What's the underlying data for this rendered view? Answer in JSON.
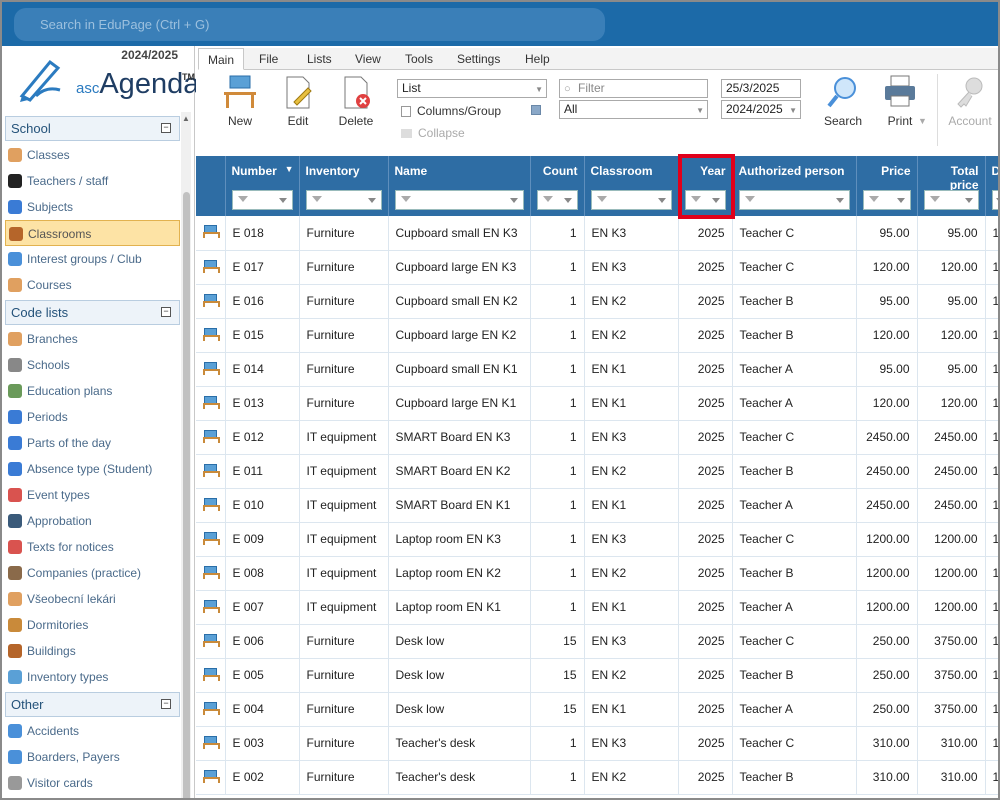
{
  "search": {
    "placeholder": "Search in EduPage (Ctrl + G)"
  },
  "logo": {
    "year": "2024/2025",
    "brand_prefix": "asc",
    "brand_name": "Agenda",
    "tm": "TM"
  },
  "sidebar": {
    "sections": [
      {
        "title": "School",
        "items": [
          {
            "label": "Classes",
            "icon": "classes-icon",
            "color": "#e0a060"
          },
          {
            "label": "Teachers / staff",
            "icon": "teacher-hat-icon",
            "color": "#222222"
          },
          {
            "label": "Subjects",
            "icon": "subjects-icon",
            "color": "#3a7bd5"
          },
          {
            "label": "Classrooms",
            "icon": "door-icon",
            "color": "#b5652a",
            "active": true
          },
          {
            "label": "Interest groups / Club",
            "icon": "groups-icon",
            "color": "#4a90d9"
          },
          {
            "label": "Courses",
            "icon": "courses-icon",
            "color": "#e0a060"
          }
        ]
      },
      {
        "title": "Code lists",
        "items": [
          {
            "label": "Branches",
            "icon": "branches-icon",
            "color": "#e0a060"
          },
          {
            "label": "Schools",
            "icon": "school-building-icon",
            "color": "#888888"
          },
          {
            "label": "Education plans",
            "icon": "education-plans-icon",
            "color": "#6a9a5a"
          },
          {
            "label": "Periods",
            "icon": "clock-icon",
            "color": "#3a7bd5"
          },
          {
            "label": "Parts of the day",
            "icon": "clock-icon",
            "color": "#3a7bd5"
          },
          {
            "label": "Absence type (Student)",
            "icon": "clock-icon",
            "color": "#3a7bd5"
          },
          {
            "label": "Event types",
            "icon": "calendar-icon",
            "color": "#d9534f"
          },
          {
            "label": "Approbation",
            "icon": "approbation-icon",
            "color": "#3a5a7a"
          },
          {
            "label": "Texts for notices",
            "icon": "pin-icon",
            "color": "#d9534f"
          },
          {
            "label": "Companies (practice)",
            "icon": "companies-icon",
            "color": "#8a6a4a"
          },
          {
            "label": "Všeobecní lekári",
            "icon": "doctor-icon",
            "color": "#e0a060"
          },
          {
            "label": "Dormitories",
            "icon": "dormitory-icon",
            "color": "#c98a3a"
          },
          {
            "label": "Buildings",
            "icon": "building-icon",
            "color": "#b5652a"
          },
          {
            "label": "Inventory types",
            "icon": "inventory-icon",
            "color": "#5aa0d6"
          }
        ]
      },
      {
        "title": "Other",
        "items": [
          {
            "label": "Accidents",
            "icon": "accidents-icon",
            "color": "#4a90d9"
          },
          {
            "label": "Boarders, Payers",
            "icon": "boarders-icon",
            "color": "#4a90d9"
          },
          {
            "label": "Visitor cards",
            "icon": "visitor-card-icon",
            "color": "#999999"
          }
        ]
      }
    ]
  },
  "tabs": [
    "Main",
    "File",
    "Lists",
    "View",
    "Tools",
    "Settings",
    "Help"
  ],
  "toolbar": {
    "new_label": "New",
    "edit_label": "Edit",
    "delete_label": "Delete",
    "view_select": "List",
    "columns_group": "Columns/Group",
    "collapse": "Collapse",
    "filter_placeholder": "Filter",
    "filter_select": "All",
    "date": "25/3/2025",
    "school_year": "2024/2025",
    "search_label": "Search",
    "print_label": "Print",
    "account_label": "Account"
  },
  "grid": {
    "columns": [
      "Number",
      "Inventory",
      "Name",
      "Count",
      "Classroom",
      "Year",
      "Authorized person",
      "Price",
      "Total price",
      "D"
    ],
    "rows": [
      [
        "E 018",
        "Furniture",
        "Cupboard small EN K3",
        "1",
        "EN K3",
        "2025",
        "Teacher C",
        "95.00",
        "95.00",
        "1"
      ],
      [
        "E 017",
        "Furniture",
        "Cupboard large EN K3",
        "1",
        "EN K3",
        "2025",
        "Teacher C",
        "120.00",
        "120.00",
        "1"
      ],
      [
        "E 016",
        "Furniture",
        "Cupboard small EN K2",
        "1",
        "EN K2",
        "2025",
        "Teacher B",
        "95.00",
        "95.00",
        "1"
      ],
      [
        "E 015",
        "Furniture",
        "Cupboard large EN K2",
        "1",
        "EN K2",
        "2025",
        "Teacher B",
        "120.00",
        "120.00",
        "1"
      ],
      [
        "E 014",
        "Furniture",
        "Cupboard small EN K1",
        "1",
        "EN K1",
        "2025",
        "Teacher A",
        "95.00",
        "95.00",
        "1"
      ],
      [
        "E 013",
        "Furniture",
        "Cupboard large EN K1",
        "1",
        "EN K1",
        "2025",
        "Teacher A",
        "120.00",
        "120.00",
        "1"
      ],
      [
        "E 012",
        "IT equipment",
        "SMART Board EN K3",
        "1",
        "EN K3",
        "2025",
        "Teacher C",
        "2450.00",
        "2450.00",
        "1"
      ],
      [
        "E 011",
        "IT equipment",
        "SMART Board EN K2",
        "1",
        "EN K2",
        "2025",
        "Teacher B",
        "2450.00",
        "2450.00",
        "1"
      ],
      [
        "E 010",
        "IT equipment",
        "SMART Board EN K1",
        "1",
        "EN K1",
        "2025",
        "Teacher A",
        "2450.00",
        "2450.00",
        "1"
      ],
      [
        "E 009",
        "IT equipment",
        "Laptop room EN K3",
        "1",
        "EN K3",
        "2025",
        "Teacher C",
        "1200.00",
        "1200.00",
        "1"
      ],
      [
        "E 008",
        "IT equipment",
        "Laptop room EN K2",
        "1",
        "EN K2",
        "2025",
        "Teacher B",
        "1200.00",
        "1200.00",
        "1"
      ],
      [
        "E 007",
        "IT equipment",
        "Laptop room EN K1",
        "1",
        "EN K1",
        "2025",
        "Teacher A",
        "1200.00",
        "1200.00",
        "1"
      ],
      [
        "E 006",
        "Furniture",
        "Desk low",
        "15",
        "EN K3",
        "2025",
        "Teacher C",
        "250.00",
        "3750.00",
        "1"
      ],
      [
        "E 005",
        "Furniture",
        "Desk low",
        "15",
        "EN K2",
        "2025",
        "Teacher B",
        "250.00",
        "3750.00",
        "1"
      ],
      [
        "E 004",
        "Furniture",
        "Desk low",
        "15",
        "EN K1",
        "2025",
        "Teacher A",
        "250.00",
        "3750.00",
        "1"
      ],
      [
        "E 003",
        "Furniture",
        "Teacher's desk",
        "1",
        "EN K3",
        "2025",
        "Teacher C",
        "310.00",
        "310.00",
        "1"
      ],
      [
        "E 002",
        "Furniture",
        "Teacher's desk",
        "1",
        "EN K2",
        "2025",
        "Teacher B",
        "310.00",
        "310.00",
        "1"
      ]
    ]
  },
  "colors": {
    "header_bg": "#2e6da4",
    "topbar": "#1c6aa8",
    "highlight": "#e0001b",
    "active_item": "#fde3a5"
  }
}
